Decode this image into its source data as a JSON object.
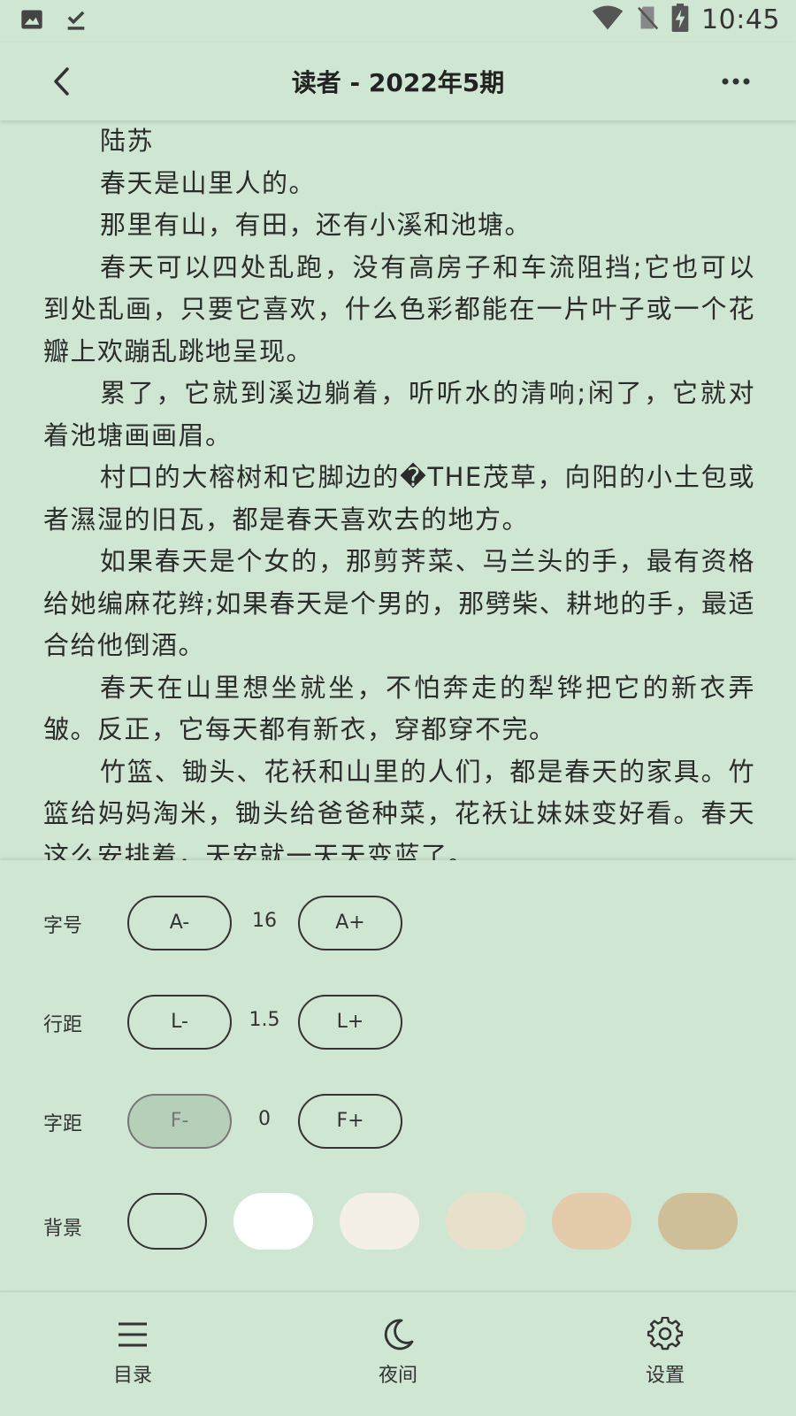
{
  "status_bar": {
    "time": "10:45",
    "icons": [
      "image-icon",
      "download-done-icon",
      "wifi-icon",
      "no-sim-icon",
      "battery-charging-icon"
    ]
  },
  "app_bar": {
    "title": "读者 - 2022年5期",
    "back_icon": "chevron-left-icon",
    "more_icon": "more-horizontal-icon"
  },
  "content": {
    "paragraphs": [
      "陆苏",
      "春天是山里人的。",
      "那里有山，有田，还有小溪和池塘。",
      "春天可以四处乱跑，没有高房子和车流阻挡;它也可以到处乱画，只要它喜欢，什么色彩都能在一片叶子或一个花瓣上欢蹦乱跳地呈现。",
      "累了，它就到溪边躺着，听听水的清响;闲了，它就对着池塘画画眉。",
      "村口的大榕树和它脚边的�THE茂草，向阳的小土包或者濕湿的旧瓦，都是春天喜欢去的地方。",
      "如果春天是个女的，那剪荠菜、马兰头的手，最有资格给她编麻花辫;如果春天是个男的，那劈柴、耕地的手，最适合给他倒酒。",
      "春天在山里想坐就坐，不怕奔走的犁铧把它的新衣弄皱。反正，它每天都有新衣，穿都穿不完。",
      "竹篮、锄头、花袄和山里的人们，都是春天的家具。竹篮给妈妈淘米，锄头给爸爸种菜，花袄让妹妹变好看。春天这么安排着，天安就一天天变蓝了。"
    ]
  },
  "settings": {
    "font_size": {
      "label": "字号",
      "dec": "A-",
      "value": "16",
      "inc": "A+"
    },
    "line_spacing": {
      "label": "行距",
      "dec": "L-",
      "value": "1.5",
      "inc": "L+"
    },
    "letter_spacing": {
      "label": "字距",
      "dec": "F-",
      "value": "0",
      "inc": "F+"
    },
    "background": {
      "label": "背景",
      "colors": [
        "#cfe6d2",
        "#ffffff",
        "#f5f0e6",
        "#e7e0cb",
        "#e3cbac",
        "#cfbf99"
      ],
      "selected_index": 0
    }
  },
  "bottom_nav": {
    "items": [
      {
        "label": "目录",
        "icon": "menu-list-icon"
      },
      {
        "label": "夜间",
        "icon": "moon-icon"
      },
      {
        "label": "设置",
        "icon": "gear-icon"
      }
    ]
  }
}
